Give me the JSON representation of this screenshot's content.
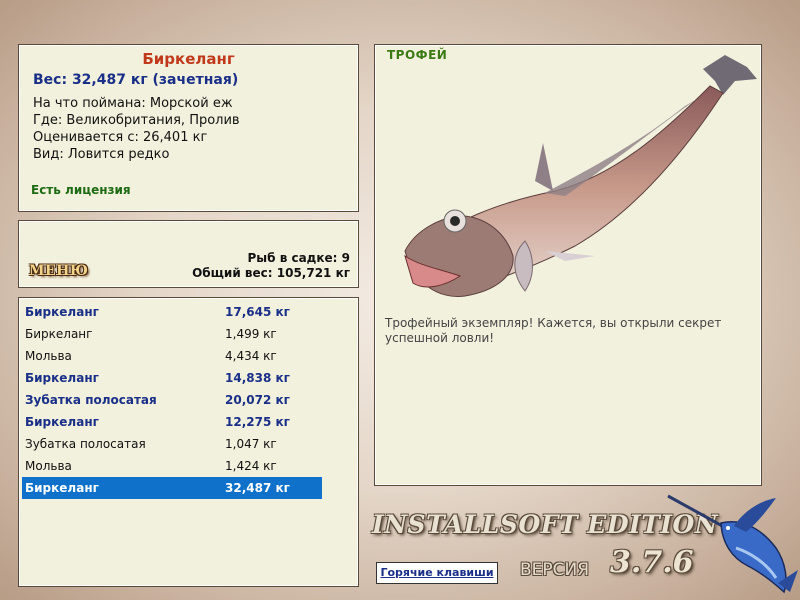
{
  "info": {
    "fish_name": "Биркеланг",
    "weight_line": "Вес: 32,487 кг (зачетная)",
    "caught_on": "На что поймана: Морской еж",
    "location": "Где: Великобритания, Пролив",
    "valued_from": "Оценивается с: 26,401 кг",
    "kind": "Вид: Ловится редко",
    "license": "Есть лицензия"
  },
  "menu": {
    "button_label": "МЕНЮ",
    "fish_in_net": "Рыб в садке: 9",
    "total_weight": "Общий вес: 105,721 кг"
  },
  "catch_list": [
    {
      "name": "Биркеланг",
      "weight": "17,645 кг",
      "style": "bold"
    },
    {
      "name": "Биркеланг",
      "weight": "1,499 кг",
      "style": "normal"
    },
    {
      "name": "Мольва",
      "weight": "4,434 кг",
      "style": "normal"
    },
    {
      "name": "Биркеланг",
      "weight": "14,838 кг",
      "style": "bold"
    },
    {
      "name": "Зубатка полосатая",
      "weight": "20,072 кг",
      "style": "bold"
    },
    {
      "name": "Биркеланг",
      "weight": "12,275 кг",
      "style": "bold"
    },
    {
      "name": "Зубатка полосатая",
      "weight": "1,047 кг",
      "style": "normal"
    },
    {
      "name": "Мольва",
      "weight": "1,424 кг",
      "style": "normal"
    },
    {
      "name": "Биркеланг",
      "weight": "32,487 кг",
      "style": "selected"
    }
  ],
  "trophy": {
    "label": "ТРОФЕЙ",
    "description": "Трофейный экземпляр! Кажется, вы открыли секрет успешной ловли!"
  },
  "footer": {
    "edition": "INSTALLSOFT EDITION",
    "version_label": "ВЕРСИЯ",
    "version_number": "3.7.6",
    "hotkeys": "Горячие клавиши"
  },
  "colors": {
    "panel_bg": "#f2f1de",
    "fish_name": "#c0391b",
    "weight_text": "#1a2f88",
    "license": "#1d6b13",
    "selection": "#0f71c9",
    "trophy_label": "#3a7a13"
  }
}
